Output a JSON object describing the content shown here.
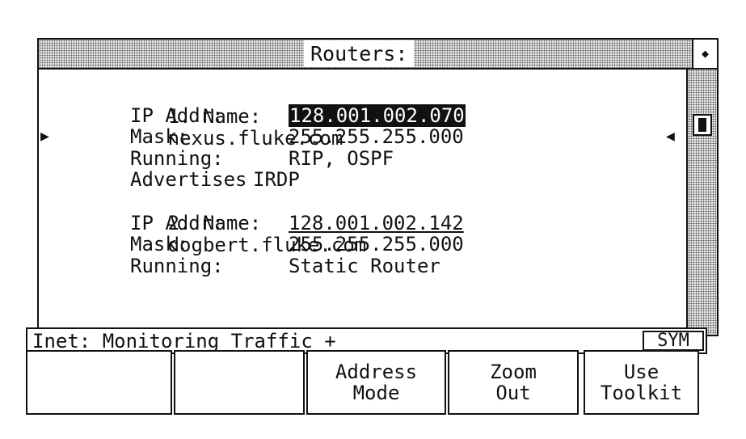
{
  "window": {
    "title": "Routers:"
  },
  "routers": [
    {
      "name_label": "1. Name:",
      "name": "nexus.fluke.com",
      "ip_label": "IP Addr:",
      "ip": "128.001.002.070",
      "mask_label": "Mask:",
      "mask": "255.255.255.000",
      "running_label": "Running:",
      "running": "RIP, OSPF",
      "advertises_label": "Advertises",
      "advertises": "IRDP"
    },
    {
      "name_label": "2. Name:",
      "name": "dogbert.fluke.com",
      "ip_label": "IP Addr:",
      "ip": "128.001.002.142",
      "mask_label": "Mask:",
      "mask": "255.255.255.000",
      "running_label": "Running:",
      "running": "Static Router"
    }
  ],
  "status": {
    "text": "Inet: Monitoring Traffic +",
    "indicator": "SYM"
  },
  "softkeys": [
    {
      "line1": "",
      "line2": ""
    },
    {
      "line1": "",
      "line2": ""
    },
    {
      "line1": "Address",
      "line2": "Mode"
    },
    {
      "line1": "Zoom",
      "line2": "Out"
    },
    {
      "line1": "Use",
      "line2": "Toolkit"
    }
  ],
  "icons": {
    "row_marker": "right-triangle",
    "scroll_marker": "left-triangle",
    "close": "diamond"
  }
}
